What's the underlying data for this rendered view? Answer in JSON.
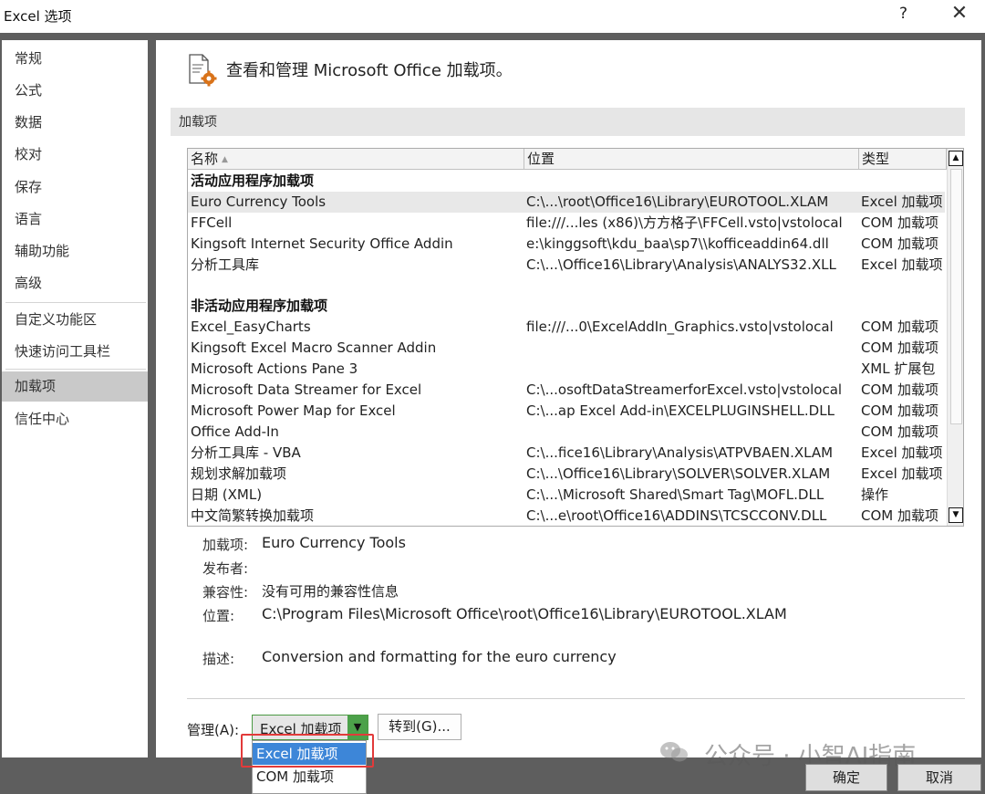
{
  "window": {
    "title": "Excel 选项",
    "help": "?",
    "close": "✕"
  },
  "sidebar": {
    "items": [
      {
        "label": "常规"
      },
      {
        "label": "公式"
      },
      {
        "label": "数据"
      },
      {
        "label": "校对"
      },
      {
        "label": "保存"
      },
      {
        "label": "语言"
      },
      {
        "label": "辅助功能"
      },
      {
        "label": "高级"
      },
      {
        "label": "自定义功能区"
      },
      {
        "label": "快速访问工具栏"
      },
      {
        "label": "加载项",
        "active": true
      },
      {
        "label": "信任中心"
      }
    ]
  },
  "header": {
    "text": "查看和管理 Microsoft Office 加载项。"
  },
  "section": {
    "title": "加载项"
  },
  "list": {
    "columns": [
      "名称",
      "位置",
      "类型"
    ],
    "groups": [
      {
        "title": "活动应用程序加载项",
        "rows": [
          {
            "name": "Euro Currency Tools",
            "location": "C:\\...\\root\\Office16\\Library\\EUROTOOL.XLAM",
            "type": "Excel 加载项",
            "selected": true
          },
          {
            "name": "FFCell",
            "location": "file:///...les (x86)\\方方格子\\FFCell.vsto|vstolocal",
            "type": "COM 加载项"
          },
          {
            "name": "Kingsoft Internet Security Office Addin",
            "location": "e:\\kinggsoft\\kdu_baa\\sp7\\\\kofficeaddin64.dll",
            "type": "COM 加载项"
          },
          {
            "name": "分析工具库",
            "location": "C:\\...\\Office16\\Library\\Analysis\\ANALYS32.XLL",
            "type": "Excel 加载项"
          }
        ]
      },
      {
        "title": "非活动应用程序加载项",
        "rows": [
          {
            "name": "Excel_EasyCharts",
            "location": "file:///...0\\ExcelAddIn_Graphics.vsto|vstolocal",
            "type": "COM 加载项"
          },
          {
            "name": "Kingsoft Excel Macro Scanner Addin",
            "location": "",
            "type": "COM 加载项"
          },
          {
            "name": "Microsoft Actions Pane 3",
            "location": "",
            "type": "XML 扩展包"
          },
          {
            "name": "Microsoft Data Streamer for Excel",
            "location": "C:\\...osoftDataStreamerforExcel.vsto|vstolocal",
            "type": "COM 加载项"
          },
          {
            "name": "Microsoft Power Map for Excel",
            "location": "C:\\...ap Excel Add-in\\EXCELPLUGINSHELL.DLL",
            "type": "COM 加载项"
          },
          {
            "name": "Office Add-In",
            "location": "",
            "type": "COM 加载项"
          },
          {
            "name": "分析工具库 - VBA",
            "location": "C:\\...fice16\\Library\\Analysis\\ATPVBAEN.XLAM",
            "type": "Excel 加载项"
          },
          {
            "name": "规划求解加载项",
            "location": "C:\\...\\Office16\\Library\\SOLVER\\SOLVER.XLAM",
            "type": "Excel 加载项"
          },
          {
            "name": "日期 (XML)",
            "location": "C:\\...\\Microsoft Shared\\Smart Tag\\MOFL.DLL",
            "type": "操作"
          },
          {
            "name": "中文简繁转换加载项",
            "location": "C:\\...e\\root\\Office16\\ADDINS\\TCSCCONV.DLL",
            "type": "COM 加载项"
          }
        ]
      }
    ]
  },
  "details": {
    "addin_label": "加载项:",
    "addin_value": "Euro Currency Tools",
    "publisher_label": "发布者:",
    "publisher_value": "",
    "compat_label": "兼容性:",
    "compat_value": "没有可用的兼容性信息",
    "location_label": "位置:",
    "location_value": "C:\\Program Files\\Microsoft Office\\root\\Office16\\Library\\EUROTOOL.XLAM",
    "desc_label": "描述:",
    "desc_value": "Conversion and formatting for the euro currency"
  },
  "manage": {
    "label": "管理(A):",
    "selected": "Excel 加载项",
    "goto_label": "转到(G)...",
    "options": [
      "Excel 加载项",
      "COM 加载项"
    ]
  },
  "buttons": {
    "ok": "确定",
    "cancel": "取消"
  },
  "watermark": "公众号 · 小智AI指南"
}
